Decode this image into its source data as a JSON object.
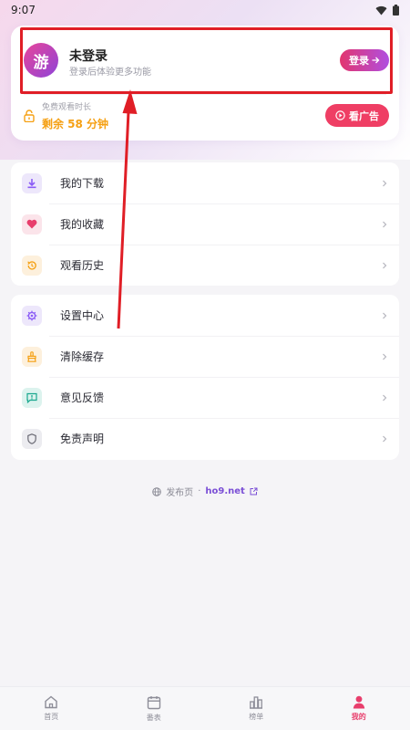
{
  "status_bar": {
    "time": "9:07",
    "icons": [
      "wifi-icon",
      "battery-icon"
    ]
  },
  "user_card": {
    "avatar_text": "游",
    "title": "未登录",
    "subtitle": "登录后体验更多功能",
    "login_button": "登录",
    "watch_time_label": "免费观看时长",
    "watch_time_remaining": "剩余 58 分钟",
    "ad_button": "看广告"
  },
  "menu_groups": [
    {
      "items": [
        {
          "label": "我的下载",
          "icon": "download-icon",
          "color": "#8b5cf6",
          "bg": "#ede7fb"
        },
        {
          "label": "我的收藏",
          "icon": "heart-icon",
          "color": "#e83e6c",
          "bg": "#fbe4ea"
        },
        {
          "label": "观看历史",
          "icon": "history-icon",
          "color": "#f5a013",
          "bg": "#fdf0dc"
        }
      ]
    },
    {
      "items": [
        {
          "label": "设置中心",
          "icon": "gear-icon",
          "color": "#8b5cf6",
          "bg": "#ede7fb"
        },
        {
          "label": "清除缓存",
          "icon": "broom-icon",
          "color": "#f5a013",
          "bg": "#fdf0dc"
        },
        {
          "label": "意见反馈",
          "icon": "feedback-icon",
          "color": "#1aa88f",
          "bg": "#dcf3ee"
        },
        {
          "label": "免责声明",
          "icon": "shield-icon",
          "color": "#6b6b75",
          "bg": "#ececf0"
        }
      ]
    }
  ],
  "footer": {
    "prefix": "发布页",
    "separator": "·",
    "domain": "ho9.net"
  },
  "bottom_nav": [
    {
      "label": "首页",
      "icon": "home-icon",
      "active": false
    },
    {
      "label": "番表",
      "icon": "calendar-icon",
      "active": false
    },
    {
      "label": "榜单",
      "icon": "ranking-icon",
      "active": false
    },
    {
      "label": "我的",
      "icon": "profile-icon",
      "active": true
    }
  ],
  "colors": {
    "accent": "#e83e6c",
    "annotation_red": "#e01e26",
    "gold": "#f5a013",
    "purple": "#8b5cf6"
  }
}
